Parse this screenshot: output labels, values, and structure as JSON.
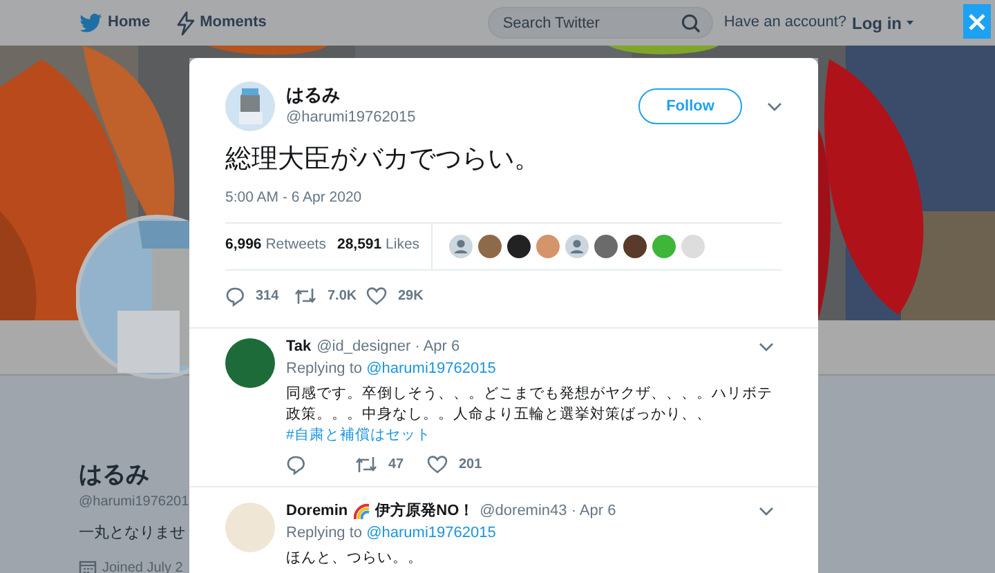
{
  "nav": {
    "items": [
      {
        "kind": "home",
        "label": "Home"
      },
      {
        "kind": "moments",
        "label": "Moments"
      }
    ],
    "search": {
      "placeholder": "Search Twitter"
    },
    "account_prompt": "Have an account?",
    "login": "Log in"
  },
  "profile": {
    "name": "はるみ",
    "handle": "@harumi1976201",
    "bio": "一丸となりませ",
    "joined": "Joined July 2"
  },
  "tweet": {
    "name": "はるみ",
    "handle": "@harumi19762015",
    "follow": "Follow",
    "text": "総理大臣がバカでつらい。",
    "time": "5:00 AM - 6 Apr 2020",
    "retweets": {
      "count": "6,996",
      "label": "Retweets"
    },
    "likes": {
      "count": "28,591",
      "label": "Likes"
    },
    "likers": [
      {
        "kind": "default"
      },
      {
        "kind": "picture"
      },
      {
        "kind": "picture"
      },
      {
        "kind": "picture"
      },
      {
        "kind": "default"
      },
      {
        "kind": "picture"
      },
      {
        "kind": "picture"
      },
      {
        "kind": "picture"
      },
      {
        "kind": "picture"
      }
    ],
    "actions": [
      {
        "kind": "reply",
        "count": "314"
      },
      {
        "kind": "retweet",
        "count": "7.0K"
      },
      {
        "kind": "like",
        "count": "29K"
      }
    ]
  },
  "replies": [
    {
      "name": "Tak",
      "has_emoji": false,
      "meta": "@id_designer · Apr 6",
      "replying_prefix": "Replying to",
      "replying_handle": "@harumi19762015",
      "text": "同感です。卒倒しそう、、。どこまでも発想がヤクザ、、、。ハリボテ政策。。。中身なし。。人命より五輪と選挙対策ばっかり、、",
      "hashtag": "#自粛と補償はセット",
      "actions": [
        {
          "kind": "reply"
        },
        {
          "kind": "retweet",
          "count": "47"
        },
        {
          "kind": "like",
          "count": "201"
        }
      ]
    },
    {
      "name": "Doremin",
      "has_emoji": true,
      "name_suffix": "伊方原発NO！",
      "meta": "@doremin43 · Apr 6",
      "replying_prefix": "Replying to",
      "replying_handle": "@harumi19762015",
      "text": "ほんと、つらい。。"
    }
  ]
}
